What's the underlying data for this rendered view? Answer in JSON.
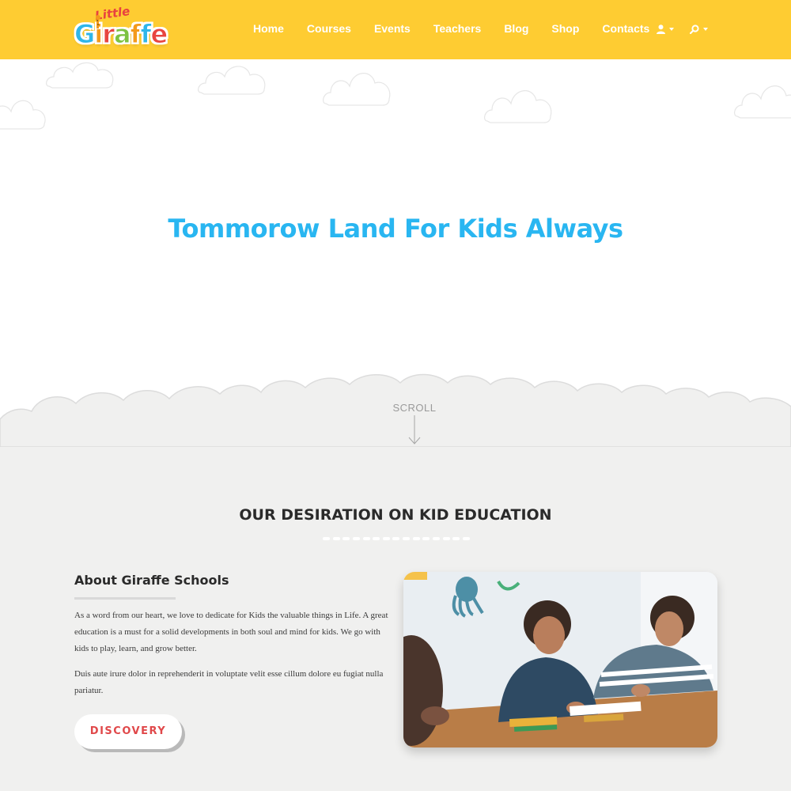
{
  "brand": {
    "logo_small": "Little",
    "logo_letters": [
      "G",
      "i",
      "r",
      "a",
      "f",
      "f",
      "e"
    ]
  },
  "nav": {
    "items": [
      {
        "label": "Home"
      },
      {
        "label": "Courses"
      },
      {
        "label": "Events"
      },
      {
        "label": "Teachers"
      },
      {
        "label": "Blog"
      },
      {
        "label": "Shop"
      },
      {
        "label": "Contacts"
      }
    ],
    "icons": [
      "user-icon",
      "search-icon"
    ]
  },
  "hero": {
    "title": "Tommorow Land For Kids Always",
    "scroll_label": "SCROLL"
  },
  "section": {
    "title": "OUR DESIRATION ON KID EDUCATION"
  },
  "about": {
    "heading": "About Giraffe Schools",
    "paragraph_1": "As a word from our heart, we love to dedicate for Kids the valuable things in Life. A great education is a must for a solid developments in both soul and mind for kids. We go with kids to play, learn, and grow better.",
    "paragraph_2": "Duis aute irure dolor in reprehenderit in voluptate velit esse cillum dolore eu fugiat nulla pariatur.",
    "button_label": "DISCOVERY"
  },
  "colors": {
    "header_bg": "#fecc32",
    "hero_title": "#29b6f1",
    "button_text": "#e0484a",
    "page_bg": "#f0f0ef"
  }
}
